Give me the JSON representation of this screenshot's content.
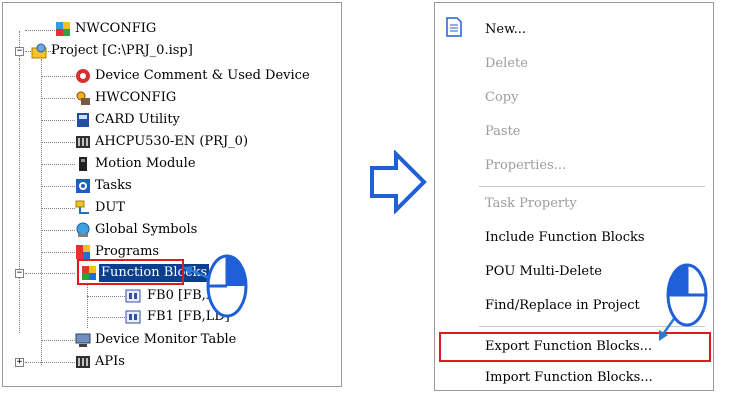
{
  "tree": {
    "items": [
      {
        "label": "NWCONFIG",
        "icon": "nwconfig-icon"
      },
      {
        "label": "Project [C:\\PRJ_0.isp]",
        "icon": "project-icon"
      },
      {
        "label": "Device Comment & Used Device",
        "icon": "device-comment-icon"
      },
      {
        "label": "HWCONFIG",
        "icon": "hwconfig-icon"
      },
      {
        "label": "CARD Utility",
        "icon": "card-utility-icon"
      },
      {
        "label": "AHCPU530-EN  (PRJ_0)",
        "icon": "cpu-icon"
      },
      {
        "label": "Motion Module",
        "icon": "motion-module-icon"
      },
      {
        "label": "Tasks",
        "icon": "tasks-icon"
      },
      {
        "label": "DUT",
        "icon": "dut-icon"
      },
      {
        "label": "Global Symbols",
        "icon": "global-symbols-icon"
      },
      {
        "label": "Programs",
        "icon": "programs-icon"
      },
      {
        "label": "Function Blocks",
        "icon": "function-blocks-icon"
      },
      {
        "label": "FB0 [FB,LD]",
        "icon": "fb-icon"
      },
      {
        "label": "FB1 [FB,LD]",
        "icon": "fb-icon"
      },
      {
        "label": "Device Monitor Table",
        "icon": "device-monitor-icon"
      },
      {
        "label": "APIs",
        "icon": "apis-icon"
      }
    ],
    "selected": "Function Blocks"
  },
  "menu": {
    "items": [
      {
        "label": "New...",
        "enabled": true
      },
      {
        "label": "Delete",
        "enabled": false
      },
      {
        "label": "Copy",
        "enabled": false
      },
      {
        "label": "Paste",
        "enabled": false
      },
      {
        "label": "Properties...",
        "enabled": false
      },
      {
        "label": "Task Property",
        "enabled": false
      },
      {
        "label": "Include Function Blocks",
        "enabled": true
      },
      {
        "label": "POU Multi-Delete",
        "enabled": true
      },
      {
        "label": "Find/Replace in Project",
        "enabled": true
      },
      {
        "label": "Export Function Blocks...",
        "enabled": true
      },
      {
        "label": "Import Function Blocks...",
        "enabled": true
      }
    ],
    "highlighted": "Export Function Blocks..."
  },
  "colors": {
    "highlight_box": "#e0191f",
    "selection": "#0a3f8f",
    "arrow_stroke": "#1f5fd8",
    "arrow_fill": "#ffffff",
    "pointer": "#2b7bd6"
  }
}
